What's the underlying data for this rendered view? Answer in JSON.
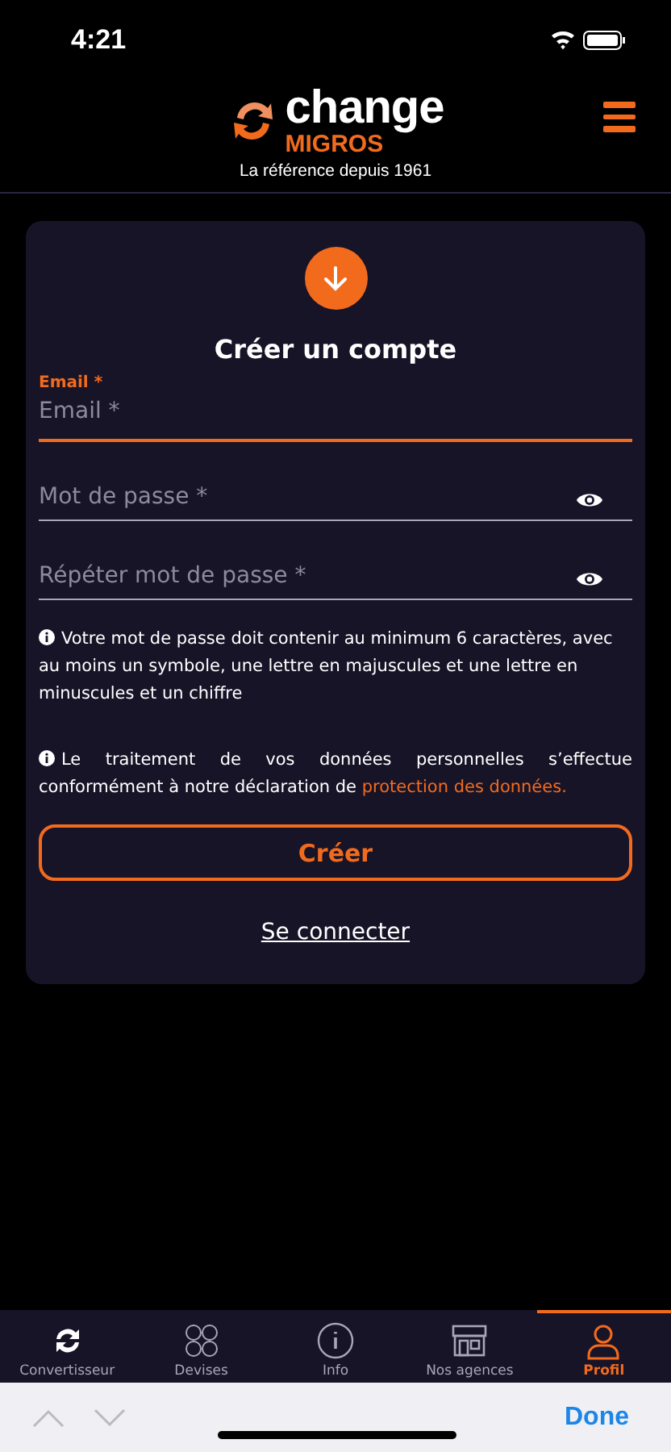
{
  "status_bar": {
    "time": "4:21"
  },
  "header": {
    "logo_word": "change",
    "logo_brand": "MIGROS",
    "tagline": "La référence depuis 1961"
  },
  "card": {
    "title": "Créer un compte",
    "fields": [
      {
        "kind": "text",
        "label": "Email *",
        "placeholder": "Email *",
        "focused": true
      },
      {
        "kind": "password",
        "placeholder": "Mot de passe *",
        "focused": false
      },
      {
        "kind": "password",
        "placeholder": "Répéter mot de passe *",
        "focused": false
      }
    ],
    "notices": [
      {
        "text": "Votre mot de passe doit contenir au minimum 6 caractères, avec au moins un symbole, une lettre en majuscules et une lettre en minuscules et un chiffre"
      },
      {
        "text": "Le traitement de vos données personnelles s’effectue conformément à notre déclaration de",
        "link": "protection des données."
      }
    ],
    "submit": "Créer",
    "login_link": "Se connecter"
  },
  "tabs": [
    {
      "label": "Convertisseur",
      "selected": false
    },
    {
      "label": "Devises",
      "selected": false
    },
    {
      "label": "Info",
      "selected": false
    },
    {
      "label": "Nos agences",
      "selected": false
    },
    {
      "label": "Profil",
      "selected": true
    }
  ],
  "keyboard_bar": {
    "done": "Done"
  }
}
